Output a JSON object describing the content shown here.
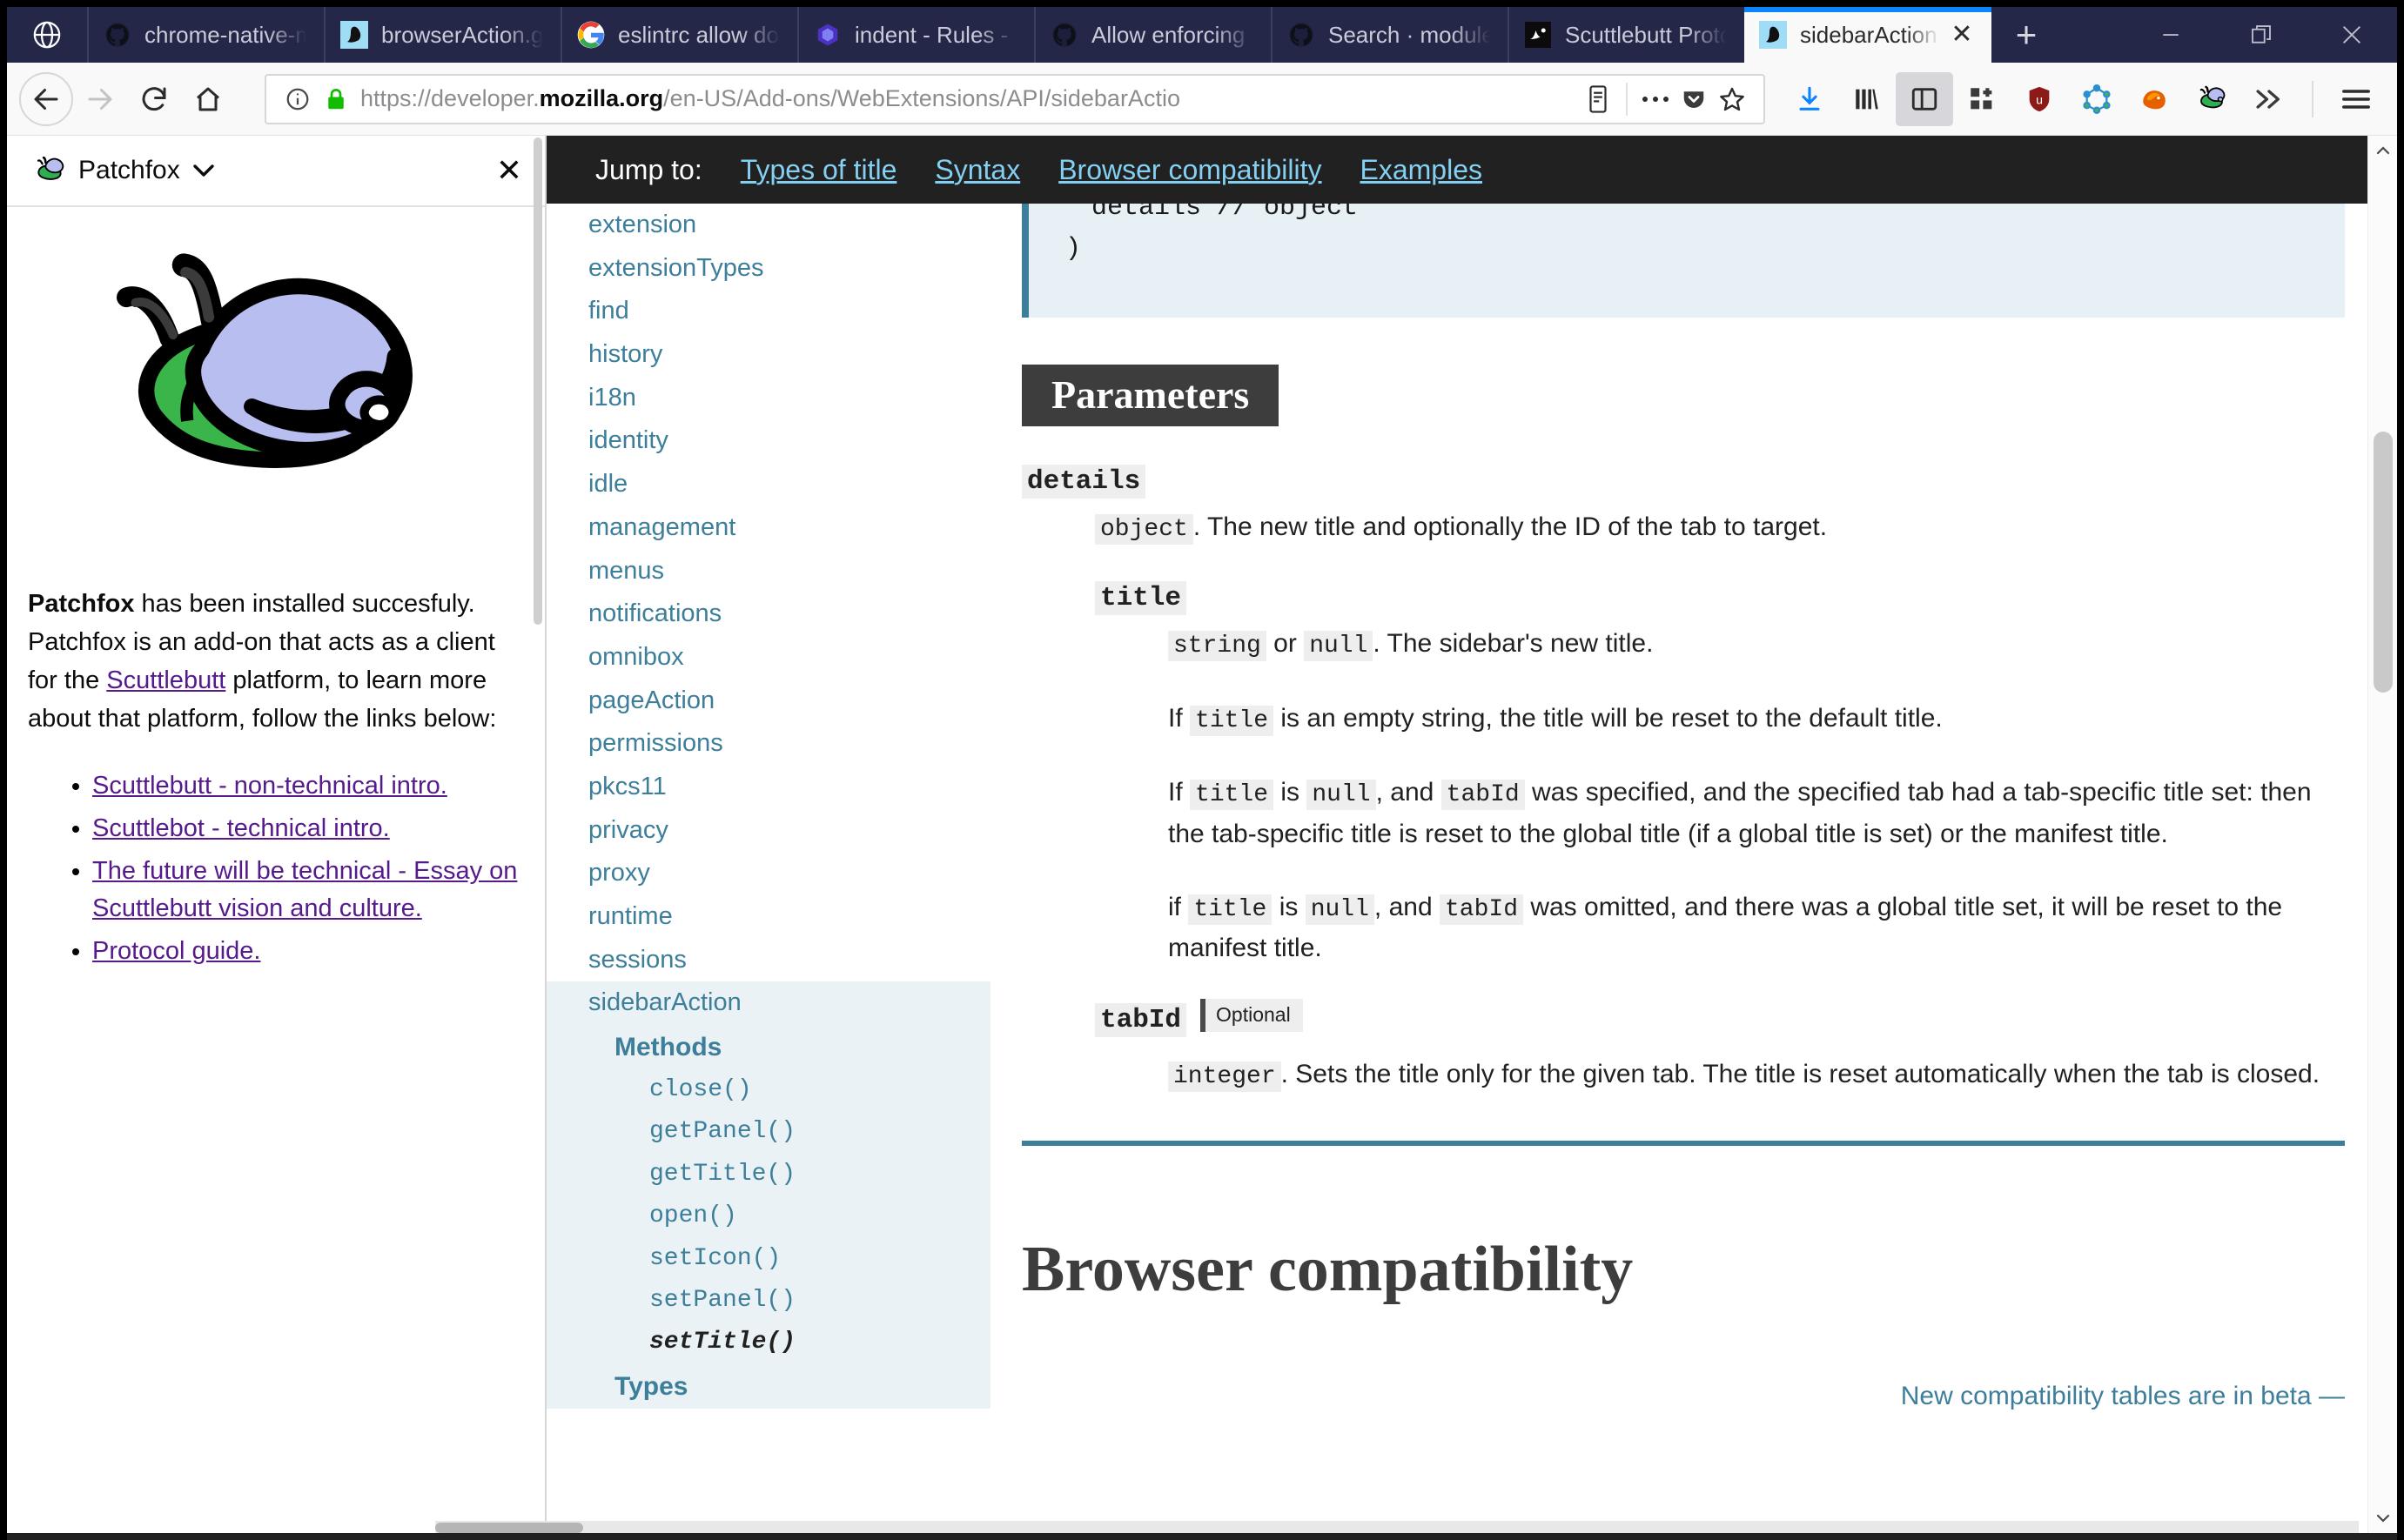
{
  "window": {
    "minimize_label": "—",
    "restore_label": "restore",
    "close_label": "✕"
  },
  "tabstrip": {
    "home_icon": "globe-icon",
    "new_tab_label": "+",
    "tabs": [
      {
        "title": "chrome-native-me",
        "favicon": "github-icon",
        "active": false
      },
      {
        "title": "browserAction.get",
        "favicon": "patchfox-icon",
        "active": false
      },
      {
        "title": "eslintrc allow dou",
        "favicon": "google-icon",
        "active": false
      },
      {
        "title": "indent - Rules - ES",
        "favicon": "eslint-icon",
        "active": false
      },
      {
        "title": "Allow enforcing si",
        "favicon": "github-icon",
        "active": false
      },
      {
        "title": "Search · modules",
        "favicon": "github-icon",
        "active": false
      },
      {
        "title": "Scuttlebutt Protoc",
        "favicon": "scuttlebutt-icon",
        "active": false
      },
      {
        "title": "sidebarAction.s",
        "favicon": "patchfox-icon",
        "active": true,
        "close_label": "✕"
      }
    ]
  },
  "navbar": {
    "back_label": "←",
    "forward_label": "→",
    "reload_label": "↻",
    "home_label": "⌂",
    "url": {
      "scheme": "https://developer.",
      "host_bold": "mozilla.org",
      "path": "/en-US/Add-ons/WebExtensions/API/sidebarActio",
      "identity_icon": "info-circle-icon",
      "lock_icon": "padlock-icon",
      "reader_icon": "reader-view-icon",
      "page_actions_icon": "ellipsis-icon",
      "pocket_icon": "pocket-icon",
      "bookmark_icon": "star-icon"
    },
    "toolbar_icons": [
      "downloads-icon",
      "library-icon",
      "sidebar-toggle-icon",
      "container-tabs-icon",
      "ublock-origin-icon",
      "graphql-icon",
      "firefox-icon",
      "patchfox-icon",
      "overflow-chevrons-icon",
      "hamburger-menu-icon"
    ]
  },
  "extension_sidebar": {
    "title": "Patchfox",
    "caret_icon": "chevron-down-icon",
    "close_label": "✕",
    "logo_icon": "patchfox-snail-logo",
    "paragraph": {
      "bold_lead": "Patchfox",
      "part1": " has been installed succesfuly. Patchfox is an add-on that acts as a client for the ",
      "link": "Scuttlebutt",
      "part2": " platform, to learn more about that platform, follow the links below:"
    },
    "links": [
      "Scuttlebutt - non-technical intro.",
      "Scuttlebot - technical intro.",
      "The future will be technical - Essay on Scuttlebutt vision and culture.",
      "Protocol guide."
    ]
  },
  "jumpbar": {
    "label": "Jump to:",
    "links": [
      "Types of title",
      "Syntax",
      "Browser compatibility",
      "Examples"
    ]
  },
  "mdn_nav": [
    {
      "label": "extension",
      "level": 0
    },
    {
      "label": "extensionTypes",
      "level": 0
    },
    {
      "label": "find",
      "level": 0
    },
    {
      "label": "history",
      "level": 0
    },
    {
      "label": "i18n",
      "level": 0
    },
    {
      "label": "identity",
      "level": 0
    },
    {
      "label": "idle",
      "level": 0
    },
    {
      "label": "management",
      "level": 0
    },
    {
      "label": "menus",
      "level": 0
    },
    {
      "label": "notifications",
      "level": 0
    },
    {
      "label": "omnibox",
      "level": 0
    },
    {
      "label": "pageAction",
      "level": 0
    },
    {
      "label": "permissions",
      "level": 0
    },
    {
      "label": "pkcs11",
      "level": 0
    },
    {
      "label": "privacy",
      "level": 0
    },
    {
      "label": "proxy",
      "level": 0
    },
    {
      "label": "runtime",
      "level": 0
    },
    {
      "label": "sessions",
      "level": 0
    },
    {
      "label": "sidebarAction",
      "level": 0,
      "highlight": true
    },
    {
      "label": "Methods",
      "level": 1,
      "highlight": true
    },
    {
      "label": "close()",
      "level": 2,
      "highlight": true
    },
    {
      "label": "getPanel()",
      "level": 2,
      "highlight": true
    },
    {
      "label": "getTitle()",
      "level": 2,
      "highlight": true
    },
    {
      "label": "open()",
      "level": 2,
      "highlight": true
    },
    {
      "label": "setIcon()",
      "level": 2,
      "highlight": true
    },
    {
      "label": "setPanel()",
      "level": 2,
      "highlight": true
    },
    {
      "label": "setTitle()",
      "level": 2,
      "highlight": true,
      "current": true
    },
    {
      "label": "Types",
      "level": 1,
      "highlight": true
    }
  ],
  "article": {
    "code_line_1": "details // object",
    "code_line_2": ")",
    "parameters_heading": "Parameters",
    "details_term": "details",
    "details_type": "object",
    "details_desc": ". The new title and optionally the ID of the tab to target.",
    "title_term": "title",
    "title_desc_1_a": "string",
    "title_desc_1_or": " or ",
    "title_desc_1_b": "null",
    "title_desc_1_rest": ". The sidebar's new title.",
    "title_p2_pre": "If ",
    "title_p2_code": "title",
    "title_p2_post": " is an empty string, the title will be reset to the default title.",
    "title_p3_pre": "If ",
    "title_p3_c1": "title",
    "title_p3_mid1": " is ",
    "title_p3_c2": "null",
    "title_p3_mid2": ", and ",
    "title_p3_c3": "tabId",
    "title_p3_post": " was specified, and the specified tab had a tab-specific title set: then the tab-specific title is reset to the global title (if a global title is set) or the manifest title.",
    "title_p4_pre": "if ",
    "title_p4_c1": "title",
    "title_p4_mid1": " is ",
    "title_p4_c2": "null",
    "title_p4_mid2": ", and ",
    "title_p4_c3": "tabId",
    "title_p4_post": " was omitted, and there was a global title set, it will be reset to the manifest title.",
    "tabid_term": "tabId",
    "tabid_optional": "Optional",
    "tabid_type": "integer",
    "tabid_desc": ". Sets the title only for the given tab. The title is reset automatically when the tab is closed.",
    "browser_compat_heading": "Browser compatibility",
    "beta_note": "New compatibility tables are in beta —"
  },
  "colors": {
    "chrome_tabstrip": "#242748",
    "active_tab_indicator": "#0a84ff",
    "mdn_link": "#3d7e9a",
    "jumpbar_bg": "#212121",
    "jumpbar_link": "#83d0f2",
    "code_bg": "#e7f0f4",
    "nav_highlight": "#eaf2f5",
    "visited_link": "#551a8b",
    "lock_green": "#12bc00"
  }
}
